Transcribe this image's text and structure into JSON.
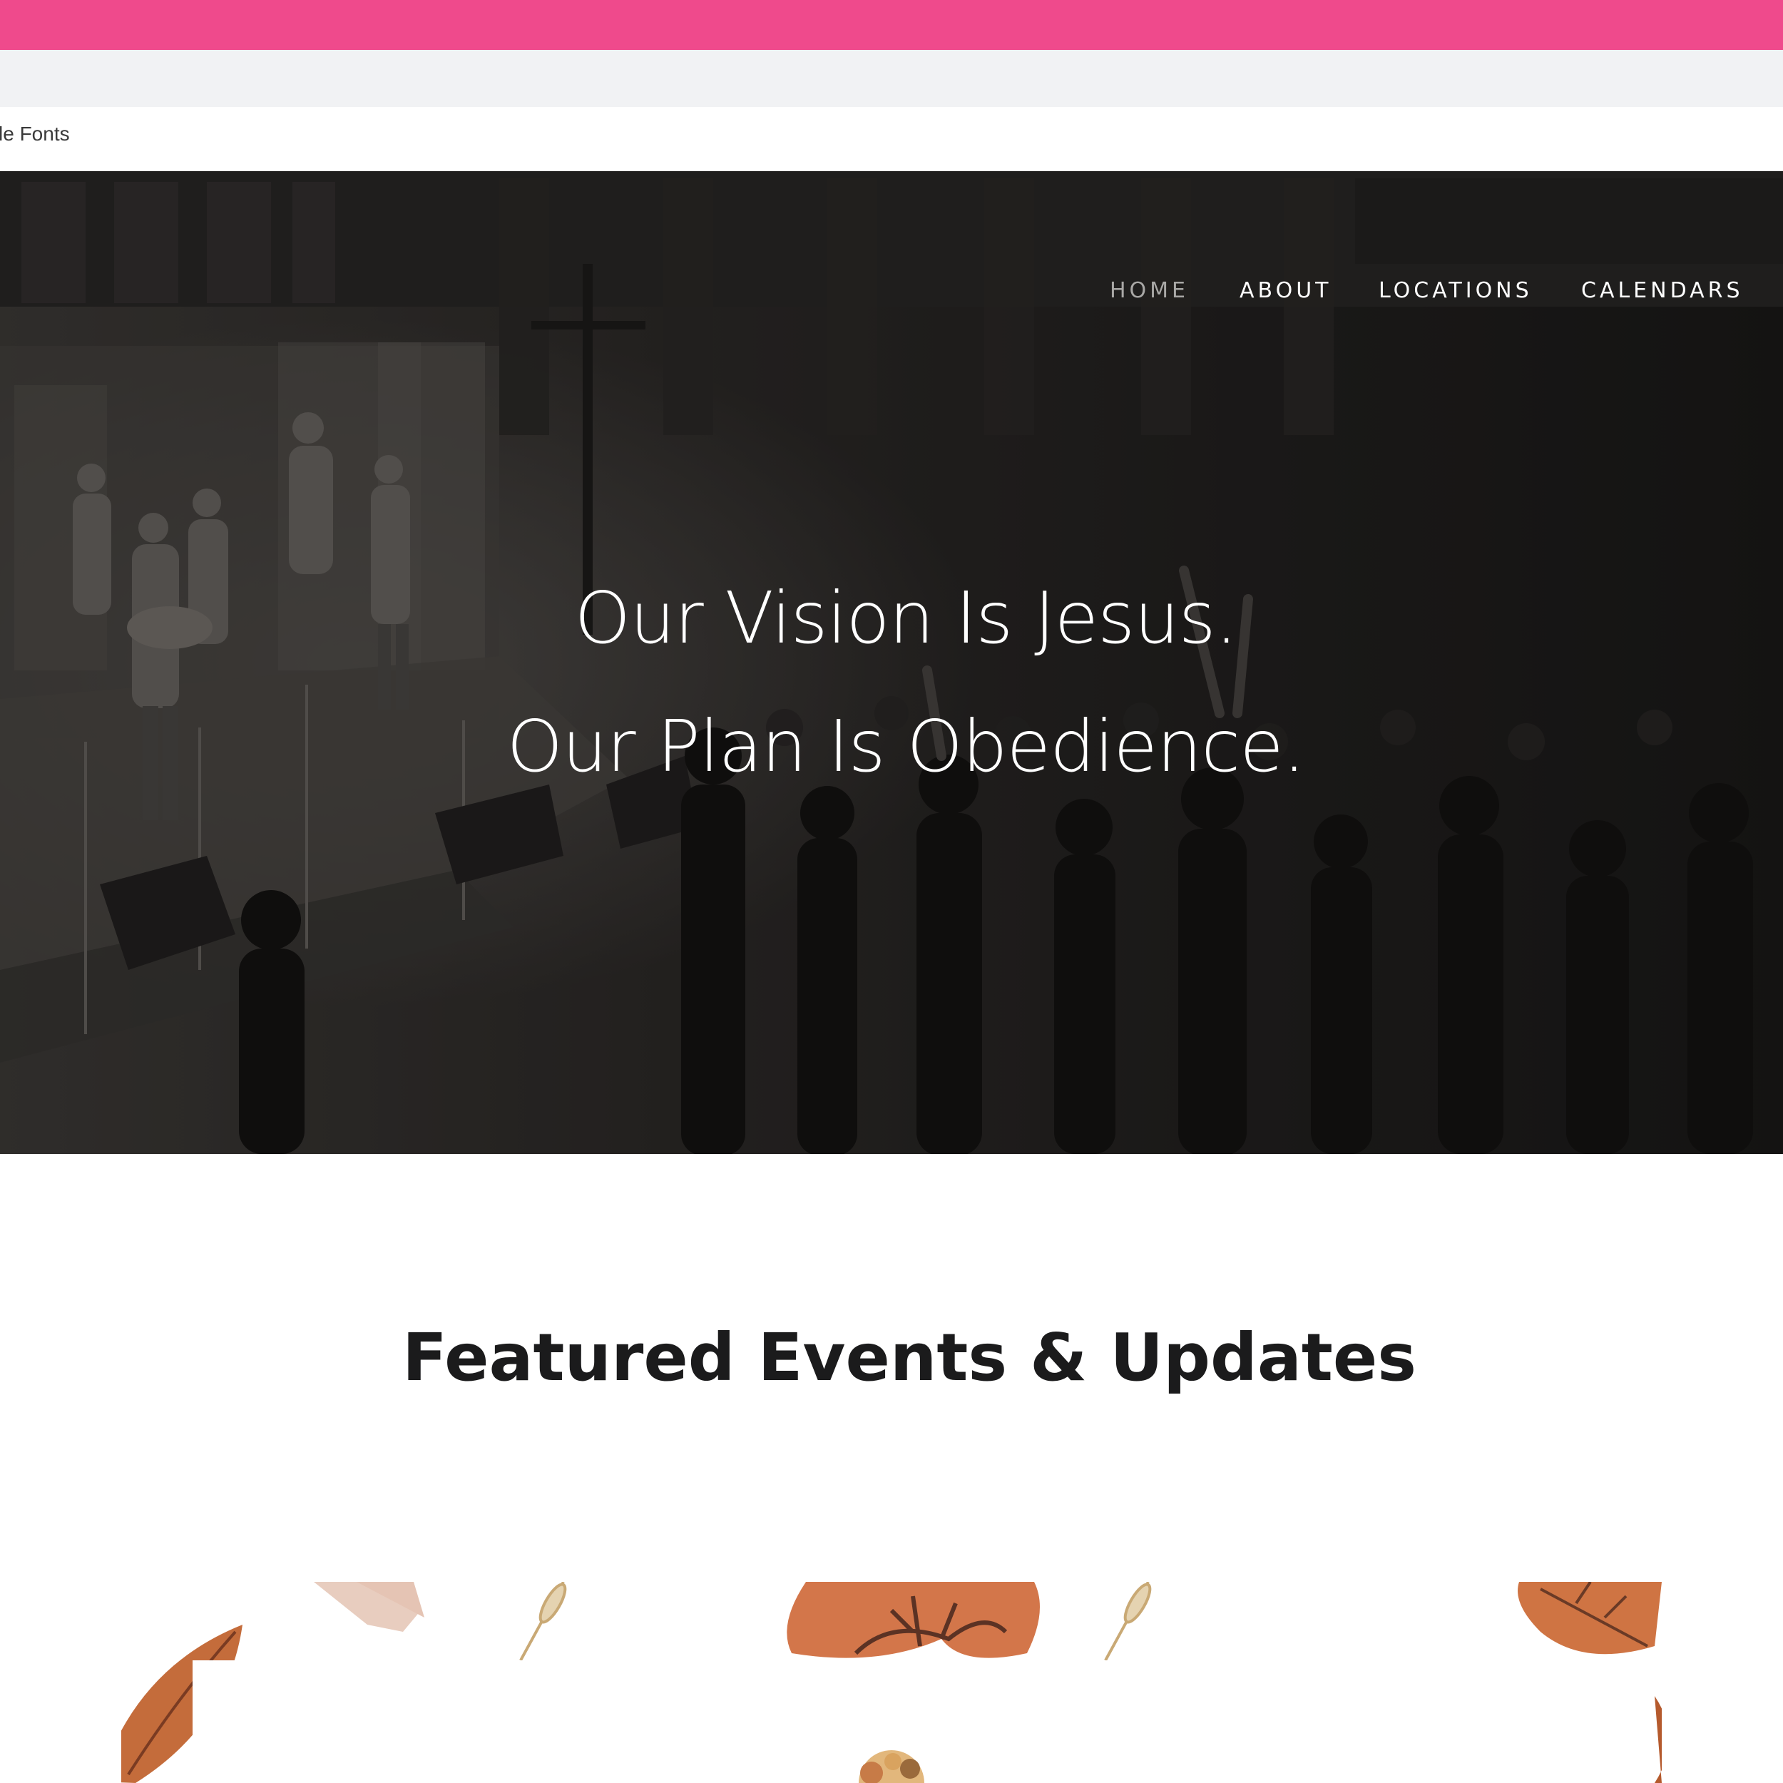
{
  "browser": {
    "bookmark_label": "le Fonts",
    "accent_color": "#ef4a8c"
  },
  "nav": {
    "items": [
      {
        "label": "HOME",
        "active": true
      },
      {
        "label": "ABOUT",
        "active": false
      },
      {
        "label": "LOCATIONS",
        "active": false
      },
      {
        "label": "CALENDARS",
        "active": false
      }
    ]
  },
  "hero": {
    "line1": "Our Vision Is Jesus.",
    "line2": "Our Plan Is Obedience.",
    "image": "worship-service-photo"
  },
  "featured": {
    "title": "Featured Events & Updates",
    "image": "autumn-leaves-illustration"
  }
}
